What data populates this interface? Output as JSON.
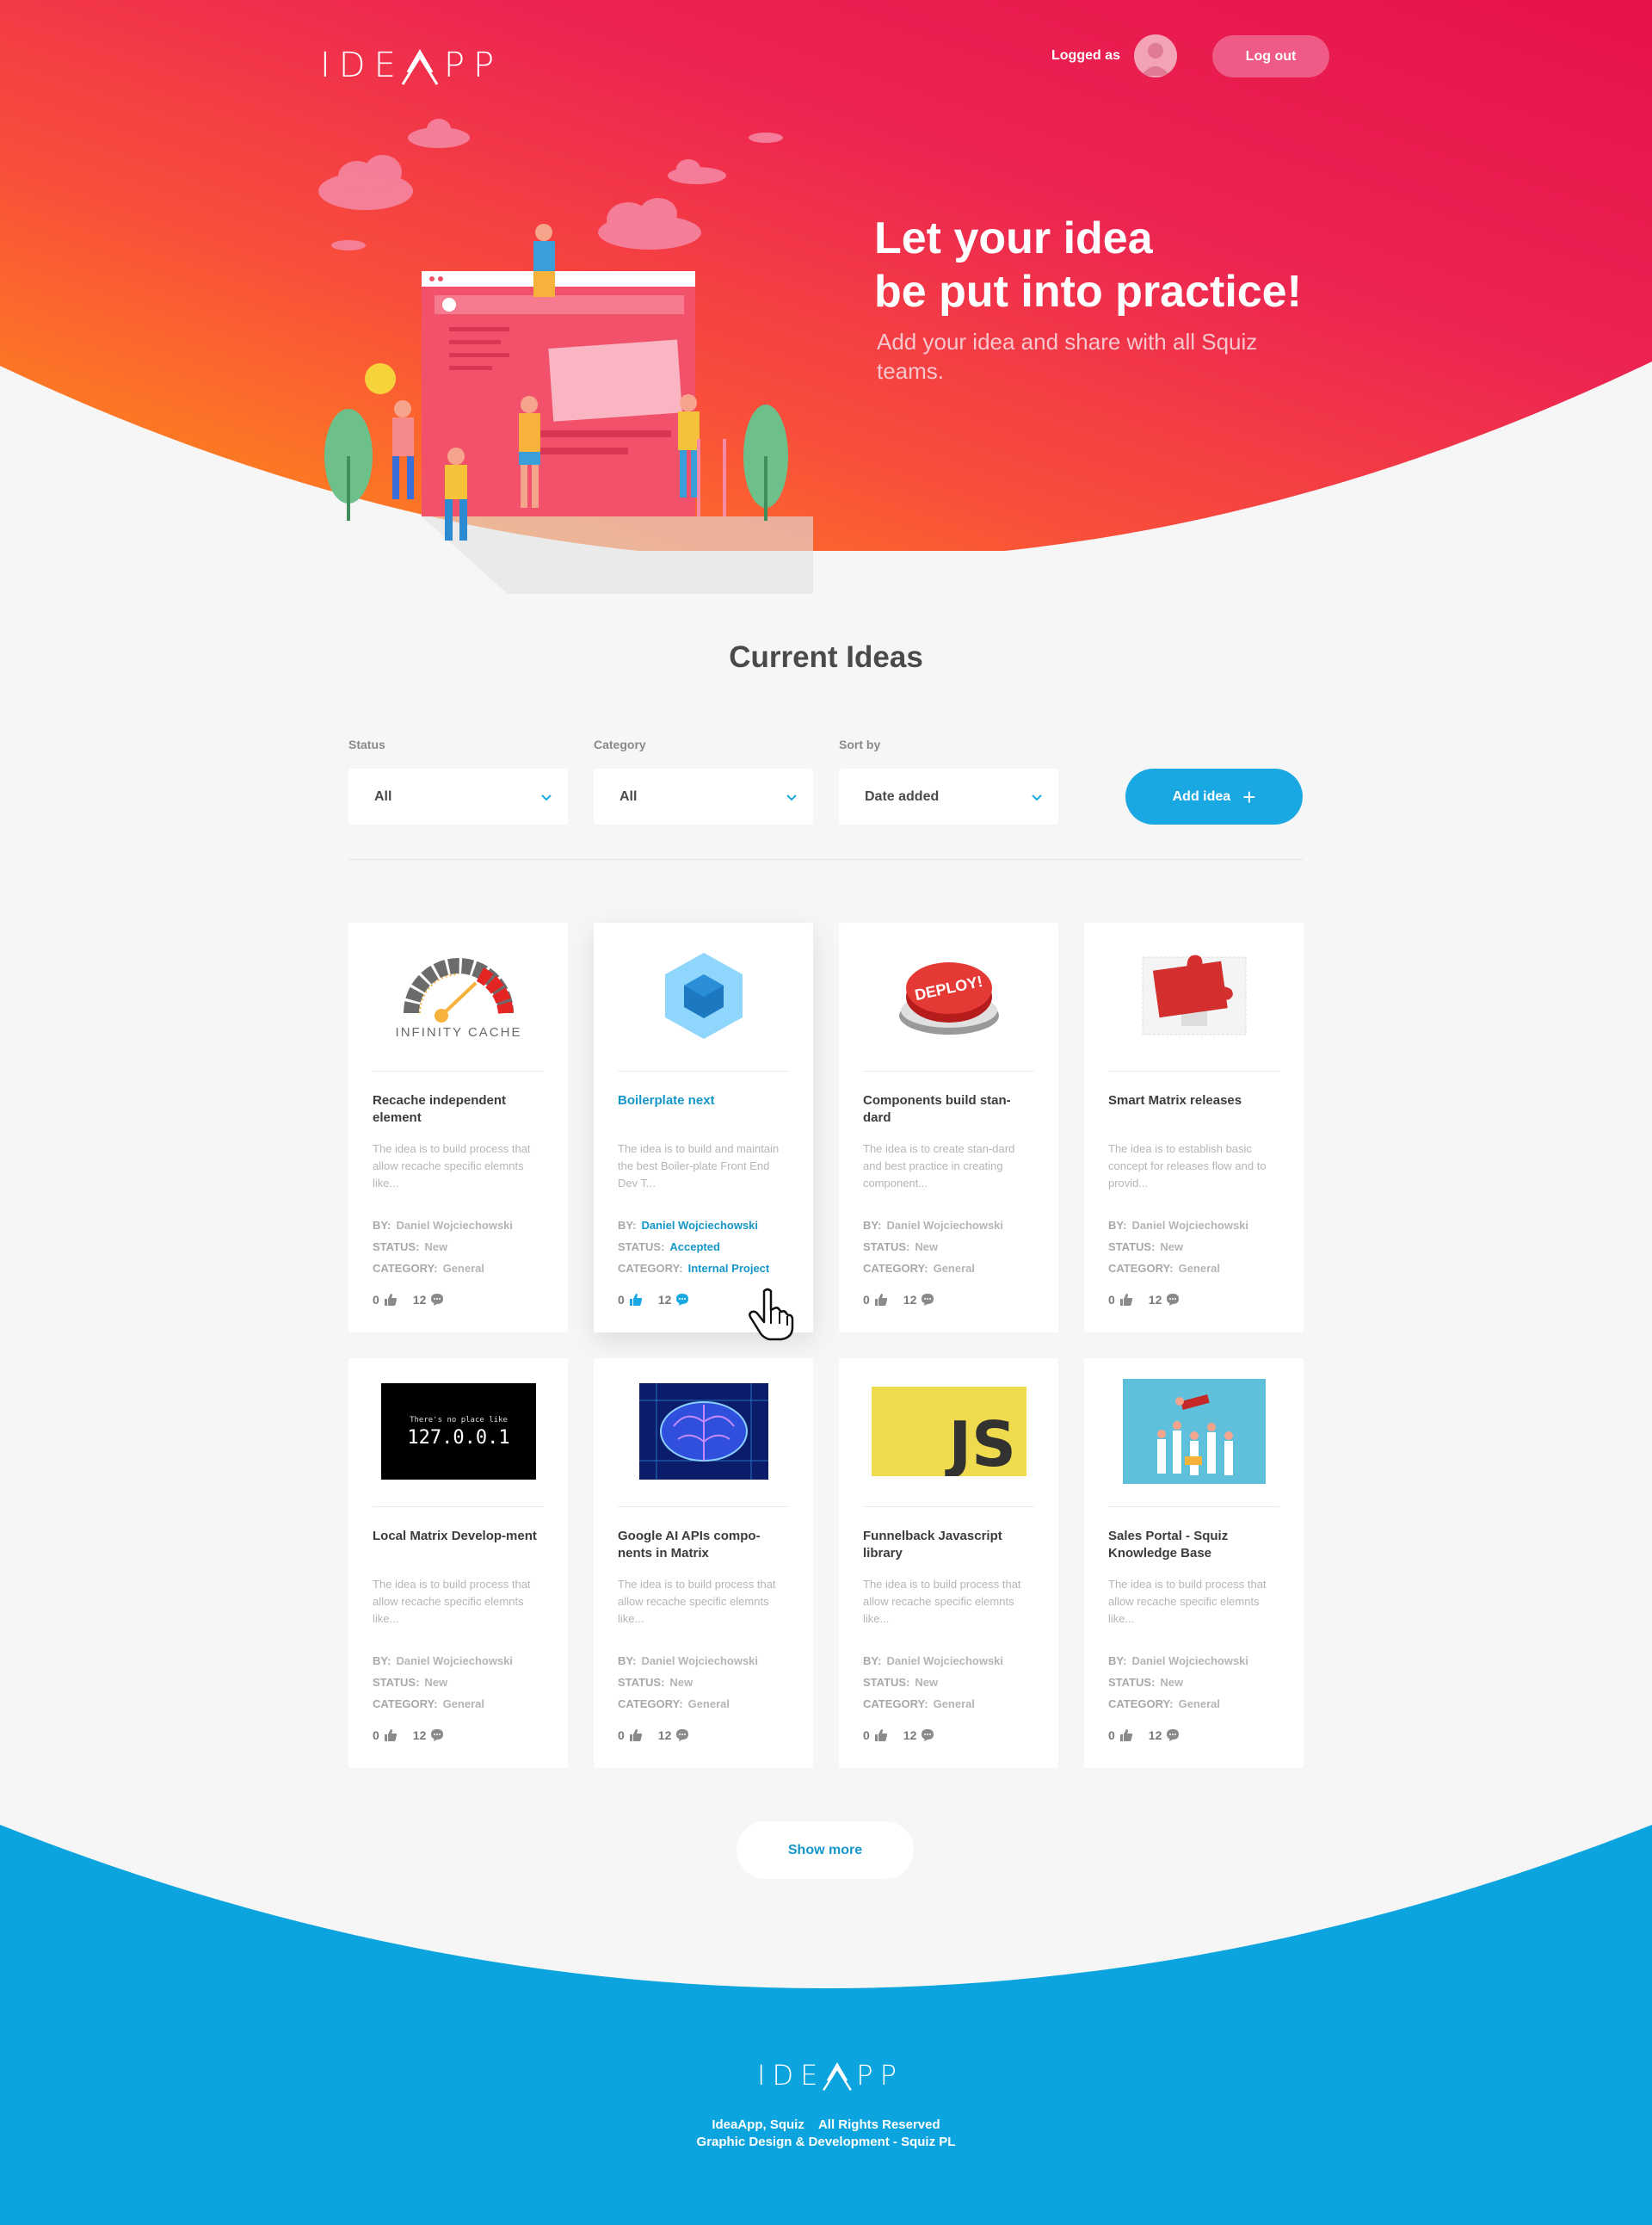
{
  "header": {
    "logo_left": "IDE",
    "logo_right": "PP",
    "logged_as": "Logged as",
    "logout": "Log out"
  },
  "hero": {
    "title_line1": "Let your idea",
    "title_line2": "be put into practice!",
    "subtitle": "Add your idea and share with all Squiz teams."
  },
  "main": {
    "title": "Current Ideas",
    "filters": {
      "status": {
        "label": "Status",
        "value": "All"
      },
      "category": {
        "label": "Category",
        "value": "All"
      },
      "sort": {
        "label": "Sort by",
        "value": "Date added"
      }
    },
    "add_idea": "Add idea",
    "show_more": "Show more"
  },
  "card_labels": {
    "by": "BY:",
    "status": "STATUS:",
    "category": "CATEGORY:"
  },
  "cards": [
    {
      "title": "Recache independent element",
      "desc": "The idea is to build process that allow recache specific elemnts like...",
      "by": "Daniel Wojciechowski",
      "status": "New",
      "category": "General",
      "likes": "0",
      "comments": "12",
      "image": "infinity-cache-gauge",
      "image_text": "INFINITY CACHE"
    },
    {
      "title": "Boilerplate next",
      "desc": "The idea is to build and maintain the best Boiler-plate Front End Dev T...",
      "by": "Daniel Wojciechowski",
      "status": "Accepted",
      "category": "Internal Project",
      "likes": "0",
      "comments": "12",
      "image": "webpack-cube"
    },
    {
      "title": "Components build stan-dard",
      "desc": "The idea is to create stan-dard and best practice in creating component...",
      "by": "Daniel Wojciechowski",
      "status": "New",
      "category": "General",
      "likes": "0",
      "comments": "12",
      "image": "deploy-button",
      "image_text": "DEPLOY!"
    },
    {
      "title": "Smart Matrix releases",
      "desc": "The idea is to establish basic concept for releases flow and to provid...",
      "by": "Daniel Wojciechowski",
      "status": "New",
      "category": "General",
      "likes": "0",
      "comments": "12",
      "image": "puzzle-piece"
    },
    {
      "title": "Local Matrix Develop-ment",
      "desc": "The idea is to build process that allow recache specific elemnts like...",
      "by": "Daniel Wojciechowski",
      "status": "New",
      "category": "General",
      "likes": "0",
      "comments": "12",
      "image": "localhost-screen",
      "image_text_small": "There's no place like",
      "image_text": "127.0.0.1"
    },
    {
      "title": "Google AI APIs compo-nents in Matrix",
      "desc": "The idea is to build process that allow recache specific elemnts like...",
      "by": "Daniel Wojciechowski",
      "status": "New",
      "category": "General",
      "likes": "0",
      "comments": "12",
      "image": "ai-brain"
    },
    {
      "title": "Funnelback Javascript library",
      "desc": "The idea is to build process that allow recache specific elemnts like...",
      "by": "Daniel Wojciechowski",
      "status": "New",
      "category": "General",
      "likes": "0",
      "comments": "12",
      "image": "js-logo",
      "image_text": "JS"
    },
    {
      "title": "Sales Portal - Squiz Knowledge Base",
      "desc": "The idea is to build process that allow recache specific elemnts like...",
      "by": "Daniel Wojciechowski",
      "status": "New",
      "category": "General",
      "likes": "0",
      "comments": "12",
      "image": "team-celebration"
    }
  ],
  "footer": {
    "line1": "IdeaApp, Squiz    All Rights Reserved",
    "line2": "Graphic Design & Development - Squiz PL"
  },
  "colors": {
    "accent": "#1aa8e3",
    "hero_pink": "#e8154b",
    "hero_orange": "#ff8a1c",
    "footer_blue": "#0ba4de"
  }
}
